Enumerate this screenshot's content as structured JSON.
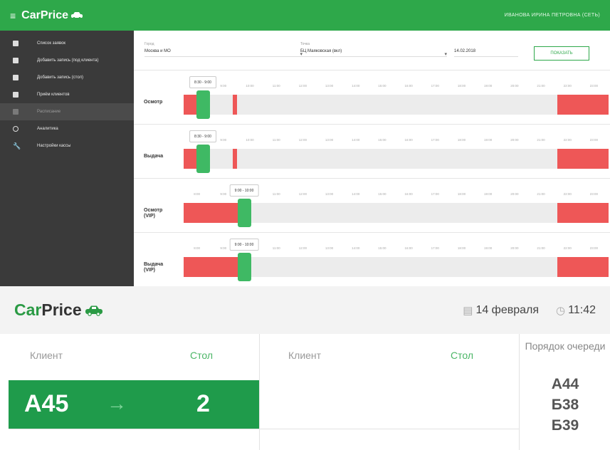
{
  "top": {
    "brand": {
      "car": "Car",
      "price": "Price"
    },
    "user": "ИВАНОВА ИРИНА ПЕТРОВНА (СЕТЬ)",
    "sidebar": [
      {
        "label": "Список заявок",
        "icon": "list-icon"
      },
      {
        "label": "Добавить запись (под клиента)",
        "icon": "add-icon"
      },
      {
        "label": "Добавить запись (стол)",
        "icon": "add-icon"
      },
      {
        "label": "Приём клиентов",
        "icon": "user-icon"
      },
      {
        "label": "Расписание",
        "icon": "calendar-icon",
        "active": true
      },
      {
        "label": "Аналитика",
        "icon": "chart-icon"
      },
      {
        "label": "Настройки кассы",
        "icon": "wrench-icon"
      }
    ],
    "filters": {
      "city_label": "Город",
      "city_value": "Москва и МО",
      "branch_label": "Точка",
      "branch_value": "БЦ Маяковская (вкл)",
      "date_value": "14.02.2018",
      "button": "ПОКАЗАТЬ"
    },
    "ticks": [
      "8:00",
      "9:00",
      "10:00",
      "11:00",
      "12:00",
      "13:00",
      "14:00",
      "15:00",
      "16:00",
      "17:00",
      "18:00",
      "19:00",
      "20:00",
      "21:00",
      "22:00",
      "23:00"
    ],
    "lanes": [
      {
        "name": "Осмотр",
        "tooltip": "8:30 - 9:00"
      },
      {
        "name": "Выдача",
        "tooltip": "8:30 - 9:00"
      },
      {
        "name": "Осмотр (VIP)",
        "tooltip": "9:00 - 10:00"
      },
      {
        "name": "Выдача (VIP)",
        "tooltip": "9:00 - 10:00"
      }
    ]
  },
  "board": {
    "brand": {
      "car": "Car",
      "price": "Price"
    },
    "date": "14 февраля",
    "time": "11:42",
    "headers": {
      "client": "Клиент",
      "table": "Стол",
      "queue": "Порядок очереди"
    },
    "active": {
      "client": "A45",
      "table": "2"
    },
    "queue": [
      "A44",
      "Б38",
      "Б39"
    ]
  }
}
